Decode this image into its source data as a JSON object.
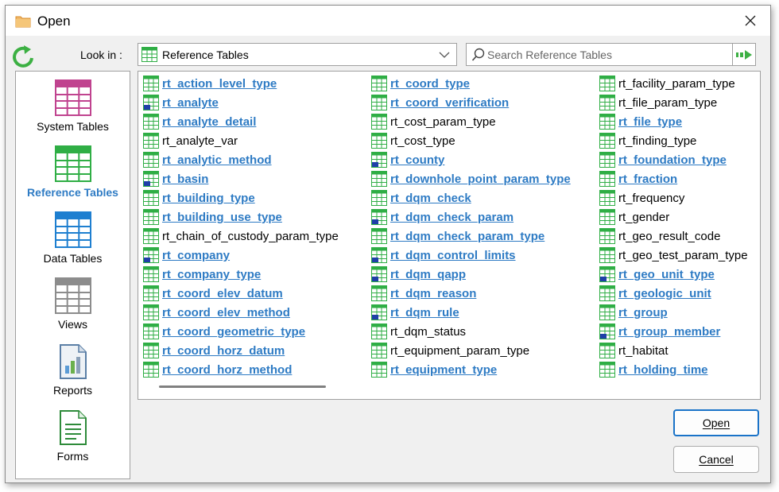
{
  "window": {
    "title": "Open"
  },
  "lookin": {
    "label": "Look in :",
    "value": "Reference Tables"
  },
  "search": {
    "placeholder": "Search Reference Tables"
  },
  "sidebar": {
    "items": [
      {
        "label": "System Tables",
        "icon": "table-pink-icon",
        "color": "#c0438f",
        "active": false
      },
      {
        "label": "Reference Tables",
        "icon": "table-green-icon",
        "color": "#2fae45",
        "active": true
      },
      {
        "label": "Data Tables",
        "icon": "table-blue-icon",
        "color": "#1e7fd0",
        "active": false
      },
      {
        "label": "Views",
        "icon": "table-gray-icon",
        "color": "#8c8c8c",
        "active": false
      },
      {
        "label": "Reports",
        "icon": "report-icon",
        "color": "#5b7fa6",
        "active": false
      },
      {
        "label": "Forms",
        "icon": "form-icon",
        "color": "#2e8b3a",
        "active": false
      }
    ]
  },
  "colors": {
    "accent": "#2e7bc4",
    "table_green": "#2fae45"
  },
  "tables": {
    "columns": [
      [
        {
          "name": "rt_action_level_type",
          "rel": true,
          "mark": false
        },
        {
          "name": "rt_analyte",
          "rel": true,
          "mark": true
        },
        {
          "name": "rt_analyte_detail",
          "rel": true,
          "mark": false
        },
        {
          "name": "rt_analyte_var",
          "rel": false,
          "mark": false
        },
        {
          "name": "rt_analytic_method",
          "rel": true,
          "mark": false
        },
        {
          "name": "rt_basin",
          "rel": true,
          "mark": true
        },
        {
          "name": "rt_building_type",
          "rel": true,
          "mark": false
        },
        {
          "name": "rt_building_use_type",
          "rel": true,
          "mark": false
        },
        {
          "name": "rt_chain_of_custody_param_type",
          "rel": false,
          "mark": false
        },
        {
          "name": "rt_company",
          "rel": true,
          "mark": true
        },
        {
          "name": "rt_company_type",
          "rel": true,
          "mark": false
        },
        {
          "name": "rt_coord_elev_datum",
          "rel": true,
          "mark": false
        },
        {
          "name": "rt_coord_elev_method",
          "rel": true,
          "mark": false
        },
        {
          "name": "rt_coord_geometric_type",
          "rel": true,
          "mark": false
        },
        {
          "name": "rt_coord_horz_datum",
          "rel": true,
          "mark": false
        },
        {
          "name": "rt_coord_horz_method",
          "rel": true,
          "mark": false
        }
      ],
      [
        {
          "name": "rt_coord_type",
          "rel": true,
          "mark": false
        },
        {
          "name": "rt_coord_verification",
          "rel": true,
          "mark": false
        },
        {
          "name": "rt_cost_param_type",
          "rel": false,
          "mark": false
        },
        {
          "name": "rt_cost_type",
          "rel": false,
          "mark": false
        },
        {
          "name": "rt_county",
          "rel": true,
          "mark": true
        },
        {
          "name": "rt_downhole_point_param_type",
          "rel": true,
          "mark": false
        },
        {
          "name": "rt_dqm_check",
          "rel": true,
          "mark": false
        },
        {
          "name": "rt_dqm_check_param",
          "rel": true,
          "mark": true
        },
        {
          "name": "rt_dqm_check_param_type",
          "rel": true,
          "mark": false
        },
        {
          "name": "rt_dqm_control_limits",
          "rel": true,
          "mark": true
        },
        {
          "name": "rt_dqm_qapp",
          "rel": true,
          "mark": true
        },
        {
          "name": "rt_dqm_reason",
          "rel": true,
          "mark": false
        },
        {
          "name": "rt_dqm_rule",
          "rel": true,
          "mark": true
        },
        {
          "name": "rt_dqm_status",
          "rel": false,
          "mark": false
        },
        {
          "name": "rt_equipment_param_type",
          "rel": false,
          "mark": false
        },
        {
          "name": "rt_equipment_type",
          "rel": true,
          "mark": false
        }
      ],
      [
        {
          "name": "rt_facility_param_type",
          "rel": false,
          "mark": false
        },
        {
          "name": "rt_file_param_type",
          "rel": false,
          "mark": false
        },
        {
          "name": "rt_file_type",
          "rel": true,
          "mark": false
        },
        {
          "name": "rt_finding_type",
          "rel": false,
          "mark": false
        },
        {
          "name": "rt_foundation_type",
          "rel": true,
          "mark": false
        },
        {
          "name": "rt_fraction",
          "rel": true,
          "mark": false
        },
        {
          "name": "rt_frequency",
          "rel": false,
          "mark": false
        },
        {
          "name": "rt_gender",
          "rel": false,
          "mark": false
        },
        {
          "name": "rt_geo_result_code",
          "rel": false,
          "mark": false
        },
        {
          "name": "rt_geo_test_param_type",
          "rel": false,
          "mark": false
        },
        {
          "name": "rt_geo_unit_type",
          "rel": true,
          "mark": true
        },
        {
          "name": "rt_geologic_unit",
          "rel": true,
          "mark": false
        },
        {
          "name": "rt_group",
          "rel": true,
          "mark": false
        },
        {
          "name": "rt_group_member",
          "rel": true,
          "mark": true
        },
        {
          "name": "rt_habitat",
          "rel": false,
          "mark": false
        },
        {
          "name": "rt_holding_time",
          "rel": true,
          "mark": false
        }
      ]
    ]
  },
  "buttons": {
    "open_label": "Open",
    "cancel_label": "Cancel"
  }
}
